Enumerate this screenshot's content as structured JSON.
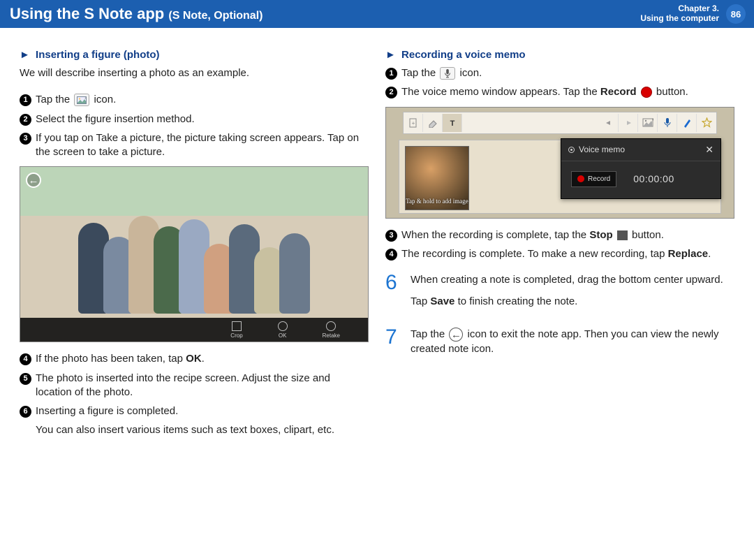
{
  "header": {
    "title_main": "Using the S Note app",
    "title_sub": "(S Note, Optional)",
    "chapter_line1": "Chapter 3.",
    "chapter_line2": "Using the computer",
    "page_no": "86"
  },
  "left": {
    "section_title": "Inserting a figure (photo)",
    "intro": "We will describe inserting a photo as an example.",
    "steps_top": [
      {
        "n": "1",
        "pre": "Tap the ",
        "post": " icon.",
        "icon": "photo"
      },
      {
        "n": "2",
        "text": "Select the figure insertion method."
      },
      {
        "n": "3",
        "text": "If you tap on Take a picture, the picture taking screen appears. Tap on the screen to take a picture."
      }
    ],
    "photo_bar": {
      "crop": "Crop",
      "ok": "OK",
      "retake": "Retake"
    },
    "steps_bottom": [
      {
        "n": "4",
        "pre": "If the photo has been taken, tap ",
        "bold": "OK",
        "post": "."
      },
      {
        "n": "5",
        "text": "The photo is inserted into the recipe screen. Adjust the size and location of the photo."
      },
      {
        "n": "6",
        "text": "Inserting a figure is completed."
      }
    ],
    "footnote": "You can also insert various items such as text boxes, clipart, etc."
  },
  "right": {
    "section_title": "Recording a voice memo",
    "steps_top": [
      {
        "n": "1",
        "pre": "Tap the ",
        "post": " icon.",
        "icon": "mic"
      },
      {
        "n": "2",
        "pre": "The voice memo window appears. Tap the ",
        "bold": "Record",
        "post": " button.",
        "trail_icon": "record"
      }
    ],
    "vm": {
      "title": "Voice memo",
      "record_label": "Record",
      "time": "00:00:00",
      "thumb_caption": "Tap & hold to add image"
    },
    "steps_mid": [
      {
        "n": "3",
        "pre": "When the recording is complete, tap the ",
        "bold": "Stop",
        "post": " button.",
        "trail_icon": "stop"
      },
      {
        "n": "4",
        "pre": "The recording is complete. To make a new recording, tap ",
        "bold": "Replace",
        "post": "."
      }
    ],
    "big6": {
      "num": "6",
      "p1": "When creating a note is completed, drag the bottom center upward.",
      "p2_pre": "Tap ",
      "p2_bold": "Save",
      "p2_post": " to finish creating the note."
    },
    "big7": {
      "num": "7",
      "p1_pre": "Tap the ",
      "p1_post": " icon to exit the note app. Then you can view the newly created note icon."
    }
  }
}
